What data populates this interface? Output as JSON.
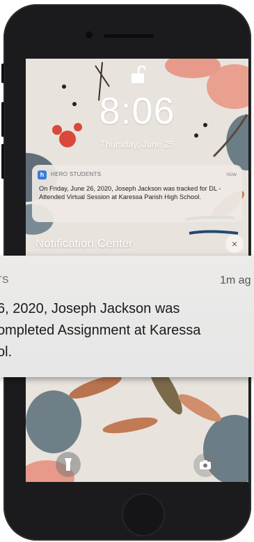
{
  "lock_screen": {
    "time": "8:06",
    "date": "Thursday, June 25"
  },
  "notification_small": {
    "app_name": "HERO STUDENTS",
    "app_icon_letter": "h",
    "time": "now",
    "body": "On Friday, June 26, 2020, Joseph Jackson was tracked for DL - Attended Virtual Session at Karessa Parish High School."
  },
  "notification_center": {
    "label": "Notification Center",
    "close_symbol": "×"
  },
  "notification_expanded": {
    "app_name_partial": "TS",
    "time_partial": "1m ag",
    "lines": [
      "6, 2020, Joseph Jackson was",
      "ompleted Assignment at Karessa",
      "ol."
    ]
  },
  "icons": {
    "lock": "unlock-icon",
    "flashlight": "flashlight-icon",
    "camera": "camera-icon",
    "close": "close-icon"
  },
  "colors": {
    "app_badge": "#3a7bd5",
    "phone_body": "#1b1b1d",
    "wallpaper": "#e8e3dd"
  }
}
